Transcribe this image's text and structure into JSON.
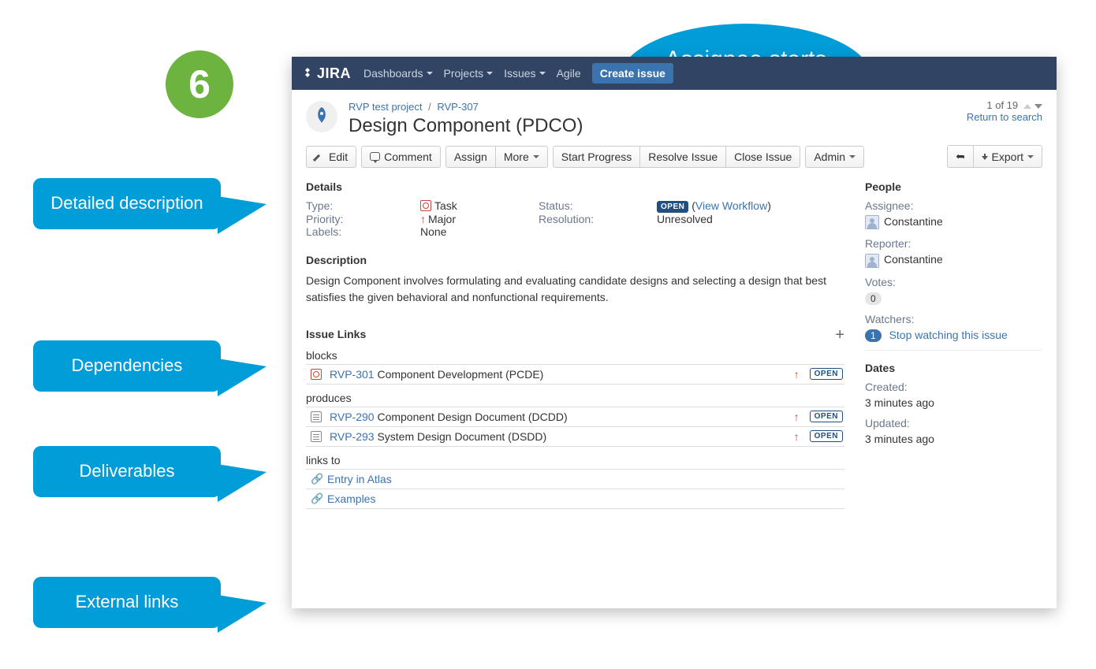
{
  "step_number": "6",
  "callouts": {
    "assignee": "Assignee starts progress",
    "description": "Detailed description",
    "dependencies": "Dependencies",
    "deliverables": "Deliverables",
    "external": "External links"
  },
  "nav": {
    "logo": "JIRA",
    "dashboards": "Dashboards",
    "projects": "Projects",
    "issues": "Issues",
    "agile": "Agile",
    "create": "Create issue"
  },
  "header": {
    "project": "RVP test project",
    "key": "RVP-307",
    "title": "Design Component (PDCO)",
    "pager": "1 of 19",
    "return": "Return to search"
  },
  "toolbar": {
    "edit": "Edit",
    "comment": "Comment",
    "assign": "Assign",
    "more": "More",
    "start": "Start Progress",
    "resolve": "Resolve Issue",
    "close": "Close Issue",
    "admin": "Admin",
    "export": "Export"
  },
  "details": {
    "heading": "Details",
    "type_label": "Type:",
    "type_value": "Task",
    "status_label": "Status:",
    "status_value": "OPEN",
    "view_workflow": "View Workflow",
    "priority_label": "Priority:",
    "priority_value": "Major",
    "resolution_label": "Resolution:",
    "resolution_value": "Unresolved",
    "labels_label": "Labels:",
    "labels_value": "None"
  },
  "description": {
    "heading": "Description",
    "text": "Design Component involves formulating and evaluating candidate designs and selecting a design that best satisfies the given behavioral and nonfunctional requirements."
  },
  "links": {
    "heading": "Issue Links",
    "blocks": "blocks",
    "block1_key": "RVP-301",
    "block1_title": "Component Development (PCDE)",
    "produces": "produces",
    "prod1_key": "RVP-290",
    "prod1_title": "Component Design Document (DCDD)",
    "prod2_key": "RVP-293",
    "prod2_title": "System Design Document (DSDD)",
    "linksto": "links to",
    "ext1": "Entry in  Atlas",
    "ext2": "Examples",
    "open": "OPEN"
  },
  "people": {
    "heading": "People",
    "assignee_label": "Assignee:",
    "assignee_value": "Constantine",
    "reporter_label": "Reporter:",
    "reporter_value": "Constantine",
    "votes_label": "Votes:",
    "votes_value": "0",
    "watchers_label": "Watchers:",
    "watchers_value": "1",
    "watchers_link": "Stop watching this issue"
  },
  "dates": {
    "heading": "Dates",
    "created_label": "Created:",
    "created_value": "3 minutes ago",
    "updated_label": "Updated:",
    "updated_value": "3 minutes ago"
  }
}
